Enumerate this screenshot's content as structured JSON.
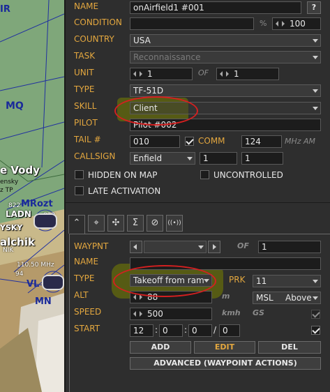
{
  "map": {
    "labels": {
      "ir": "IR",
      "mq": "MQ",
      "vody": "e Vody",
      "ensky": "ensky",
      "tp": "z TP",
      "num822a": "822",
      "num822b": "822",
      "ladn": "LADN",
      "mrozt": "MRozt",
      "ysky": "YSKY",
      "alchik": "alchik",
      "nik": "NIK",
      "freq": "110.50 MHz",
      "num94": "94",
      "vl": "VL",
      "mn": "MN"
    }
  },
  "group": {
    "name_label": "NAME",
    "name_value": "onAirfield1 #001",
    "help_button": "?",
    "condition_label": "CONDITION",
    "condition_value": "",
    "percent": "%",
    "condition_percent": "100",
    "country_label": "COUNTRY",
    "country_value": "USA",
    "task_label": "TASK",
    "task_value": "Reconnaissance",
    "unit_label": "UNIT",
    "unit_value": "1",
    "of_label": "OF",
    "unit_total": "1",
    "type_label": "TYPE",
    "type_value": "TF-51D",
    "skill_label": "SKILL",
    "skill_value": "Client",
    "pilot_label": "PILOT",
    "pilot_value": "Pilot #002",
    "tail_label": "TAIL #",
    "tail_value": "010",
    "comm_label": "COMM",
    "comm_checked": true,
    "comm_value": "124",
    "comm_unit": "MHz AM",
    "callsign_label": "CALLSIGN",
    "callsign_value": "Enfield",
    "callsign_num1": "1",
    "callsign_num2": "1",
    "hidden_label": "HIDDEN ON MAP",
    "uncontrolled_label": "UNCONTROLLED",
    "late_label": "LATE ACTIVATION"
  },
  "tabs": [
    {
      "name": "route-icon",
      "glyph": "⌃"
    },
    {
      "name": "target-icon",
      "glyph": "⌖"
    },
    {
      "name": "payload-icon",
      "glyph": "✣"
    },
    {
      "name": "summary-icon",
      "glyph": "Σ"
    },
    {
      "name": "failures-icon",
      "glyph": "⊘"
    },
    {
      "name": "radio-icon",
      "glyph": "((•))"
    }
  ],
  "waypoint": {
    "waypnt_label": "WAYPNT",
    "of_label": "OF",
    "of_value": "1",
    "name_label": "NAME",
    "name_value": "",
    "type_label": "TYPE",
    "type_value": "Takeoff from ram",
    "prk_label": "PRK",
    "prk_value": "11",
    "alt_label": "ALT",
    "alt_value": "88",
    "alt_unit": "m",
    "alt_ref": "MSL",
    "alt_mode": "Above",
    "speed_label": "SPEED",
    "speed_value": "500",
    "speed_unit": "kmh",
    "gs_label": "GS",
    "start_label": "START",
    "start_h": "12",
    "start_m": "0",
    "start_s": "0",
    "start_d": "0",
    "colon1": ":",
    "colon2": ":",
    "slash": "/",
    "add_button": "ADD",
    "edit_button": "EDIT",
    "del_button": "DEL",
    "advanced_button": "ADVANCED (WAYPOINT ACTIONS)"
  },
  "colors": {
    "label": "#e3a73f",
    "highlight": "#7a8200",
    "annotation": "#d42020"
  }
}
